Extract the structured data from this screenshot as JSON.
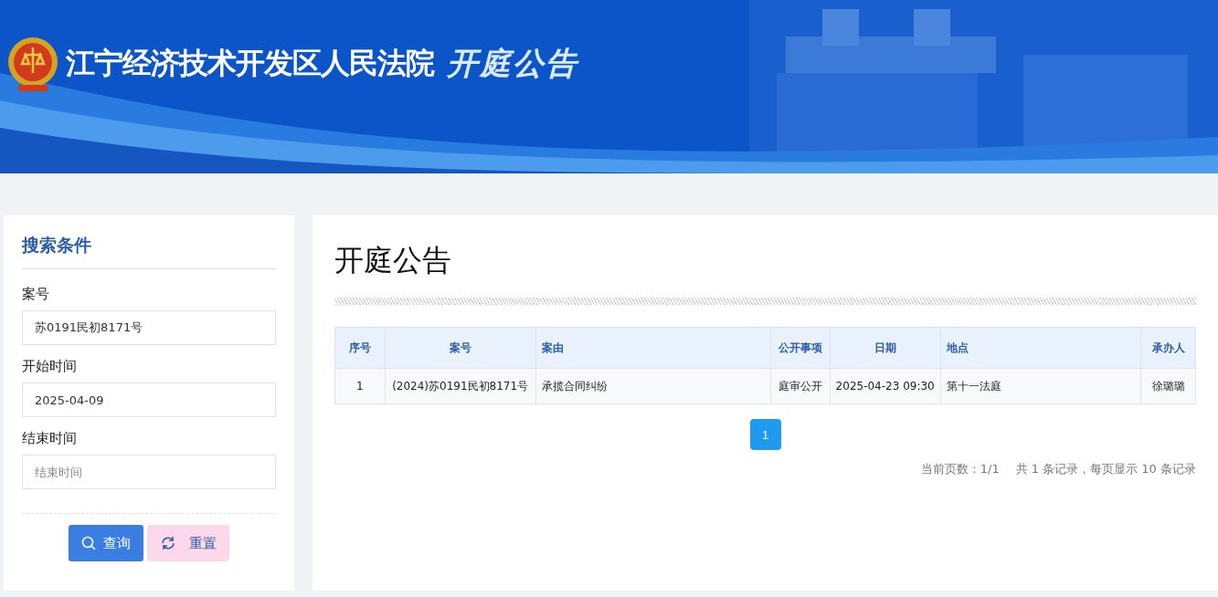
{
  "banner": {
    "court_name": "江宁经济技术开发区人民法院",
    "title": "开庭公告"
  },
  "search_panel": {
    "title": "搜索条件",
    "fields": [
      {
        "label": "案号",
        "value": "苏0191民初8171号"
      },
      {
        "label": "开始时间",
        "value": "2025-04-09"
      },
      {
        "label": "结束时间",
        "placeholder": "结束时间"
      }
    ],
    "buttons": [
      {
        "kind": "search",
        "label": "查询"
      },
      {
        "kind": "reset",
        "label": "重置"
      }
    ]
  },
  "main": {
    "title": "开庭公告",
    "table": {
      "columns": [
        "序号",
        "案号",
        "案由",
        "公开事项",
        "日期",
        "地点",
        "承办人"
      ],
      "rows": [
        [
          "1",
          "(2024)苏0191民初8171号",
          "承揽合同纠纷",
          "庭审公开",
          "2025-04-23 09:30",
          "第十一法庭",
          "徐璐璐"
        ]
      ]
    },
    "pagination": {
      "pages": [
        {
          "label": "1",
          "selected": true
        }
      ],
      "current": "当前页数：1/1",
      "summary": "共 1 条记录，每页显示 10 条记录"
    }
  }
}
